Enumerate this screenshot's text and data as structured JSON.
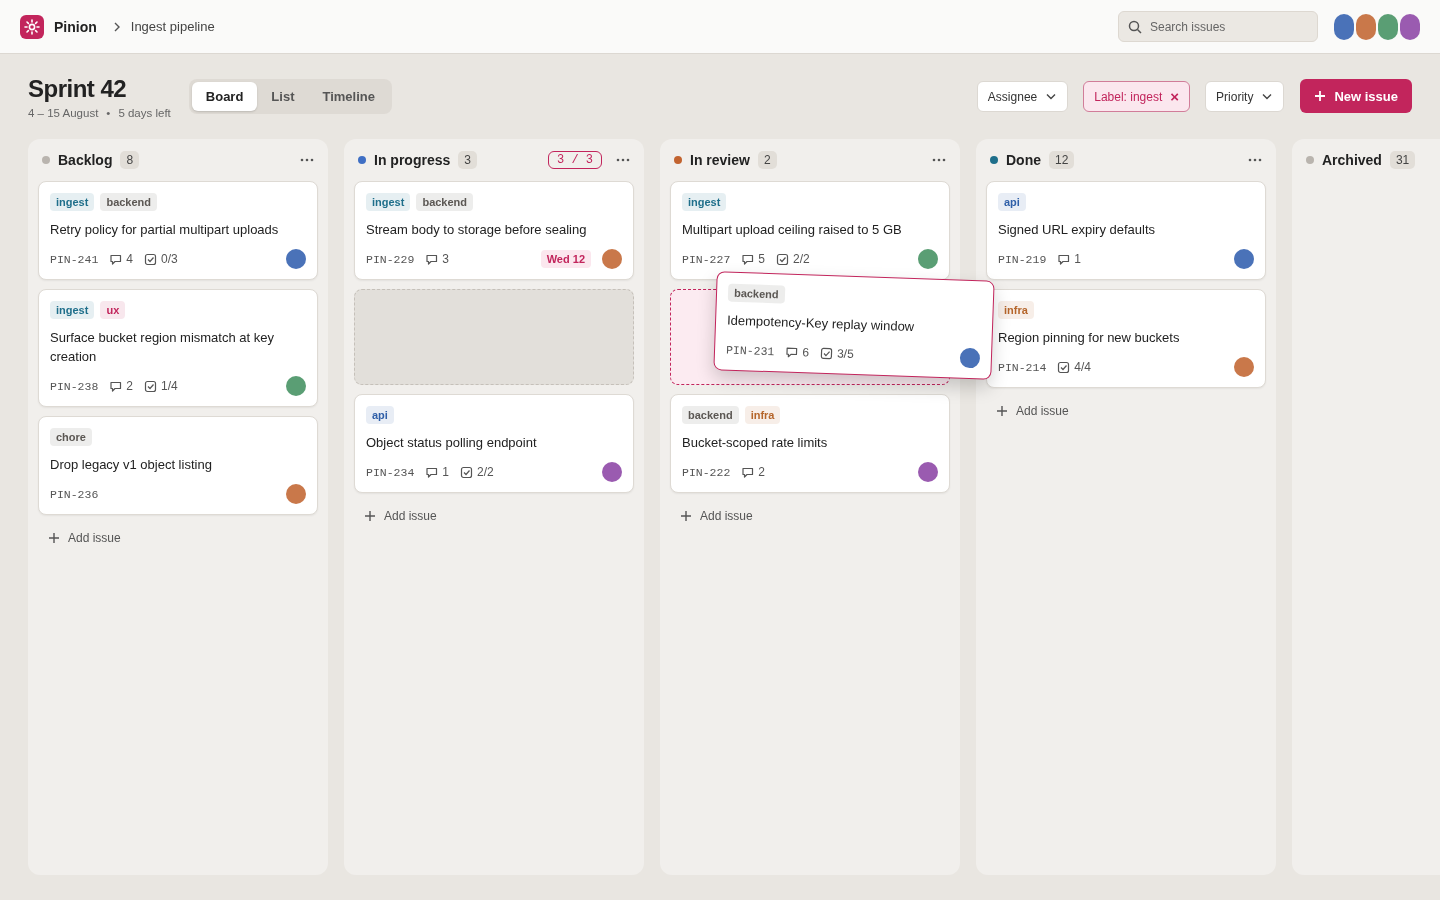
{
  "topbar": {
    "app_name": "Pinion",
    "breadcrumb": "Ingest pipeline",
    "search": {
      "placeholder": "Search issues"
    },
    "avatars": [
      {
        "color": "#4a72b8"
      },
      {
        "color": "#c9784a"
      },
      {
        "color": "#5a9e74"
      },
      {
        "color": "#9a5bb0"
      }
    ]
  },
  "sprint": {
    "title": "Sprint 42",
    "dates": "4 – 15 August",
    "separator": "•",
    "remaining": "5 days left"
  },
  "views": [
    {
      "label": "Board",
      "selected": true
    },
    {
      "label": "List",
      "selected": false
    },
    {
      "label": "Timeline",
      "selected": false
    }
  ],
  "filters": [
    {
      "kind": "dropdown",
      "label": "Assignee"
    },
    {
      "kind": "chip",
      "label": "Label: ingest",
      "remove": "×"
    },
    {
      "kind": "dropdown",
      "label": "Priority"
    }
  ],
  "new_button": {
    "label": "New issue"
  },
  "columns": [
    {
      "name": "Backlog",
      "count": "8",
      "color": "#b9b4ae",
      "menu": true,
      "add": "Add issue",
      "cards": [
        {
          "kind": "card",
          "tags": [
            {
              "label": "ingest",
              "color": "#1f6f8b"
            },
            {
              "label": "backend",
              "color": "#5b5753"
            }
          ],
          "title": "Retry policy for partial multipart uploads",
          "id": "PIN-241",
          "comments": "4",
          "checklist": "0/3",
          "avatar": {
            "color": "#4a72b8"
          }
        },
        {
          "kind": "card",
          "tags": [
            {
              "label": "ingest",
              "color": "#1f6f8b"
            },
            {
              "label": "ux",
              "color": "#c2255c"
            }
          ],
          "title": "Surface bucket region mismatch at key creation",
          "id": "PIN-238",
          "comments": "2",
          "checklist": "1/4",
          "avatar": {
            "color": "#5a9e74"
          }
        },
        {
          "kind": "card",
          "tags": [
            {
              "label": "chore",
              "color": "#5b5753"
            }
          ],
          "title": "Drop legacy v1 object listing",
          "id": "PIN-236",
          "avatar": {
            "color": "#c9784a"
          }
        }
      ]
    },
    {
      "name": "In progress",
      "count": "3",
      "color": "#3f6fc4",
      "wip": "3 / 3",
      "menu": true,
      "add": "Add issue",
      "cards": [
        {
          "kind": "card",
          "tags": [
            {
              "label": "ingest",
              "color": "#1f6f8b"
            },
            {
              "label": "backend",
              "color": "#5b5753"
            }
          ],
          "title": "Stream body to storage before sealing",
          "id": "PIN-229",
          "comments": "3",
          "due": "Wed 12",
          "avatar": {
            "color": "#c9784a"
          }
        },
        {
          "kind": "placeholder"
        },
        {
          "kind": "card",
          "tags": [
            {
              "label": "api",
              "color": "#2f5fa8"
            }
          ],
          "title": "Object status polling endpoint",
          "id": "PIN-234",
          "comments": "1",
          "checklist": "2/2",
          "avatar": {
            "color": "#9a5bb0"
          }
        }
      ]
    },
    {
      "name": "In review",
      "count": "2",
      "color": "#c2632f",
      "menu": true,
      "add": "Add issue",
      "cards": [
        {
          "kind": "card",
          "tags": [
            {
              "label": "ingest",
              "color": "#1f6f8b"
            }
          ],
          "title": "Multipart upload ceiling raised to 5 GB",
          "id": "PIN-227",
          "comments": "5",
          "checklist": "2/2",
          "avatar": {
            "color": "#5a9e74"
          }
        },
        {
          "kind": "drop-target"
        },
        {
          "kind": "card",
          "tags": [
            {
              "label": "backend",
              "color": "#5b5753"
            },
            {
              "label": "infra",
              "color": "#b5652a"
            }
          ],
          "title": "Bucket-scoped rate limits",
          "id": "PIN-222",
          "comments": "2",
          "avatar": {
            "color": "#9a5bb0"
          }
        }
      ],
      "dragging": {
        "tags": [
          {
            "label": "backend",
            "color": "#5b5753"
          }
        ],
        "title": "Idempotency-Key replay window",
        "id": "PIN-231",
        "comments": "6",
        "checklist": "3/5",
        "avatar": {
          "color": "#4a72b8"
        }
      }
    },
    {
      "name": "Done",
      "count": "12",
      "color": "#1f6f8b",
      "menu": true,
      "add": "Add issue",
      "cards": [
        {
          "kind": "card",
          "tags": [
            {
              "label": "api",
              "color": "#2f5fa8"
            }
          ],
          "title": "Signed URL expiry defaults",
          "id": "PIN-219",
          "comments": "1",
          "avatar": {
            "color": "#4a72b8"
          }
        },
        {
          "kind": "card",
          "tags": [
            {
              "label": "infra",
              "color": "#b5652a"
            }
          ],
          "title": "Region pinning for new buckets",
          "id": "PIN-214",
          "checklist": "4/4",
          "avatar": {
            "color": "#c9784a"
          }
        }
      ]
    },
    {
      "name": "Archived",
      "count": "31",
      "color": "#b9b4ae"
    }
  ]
}
